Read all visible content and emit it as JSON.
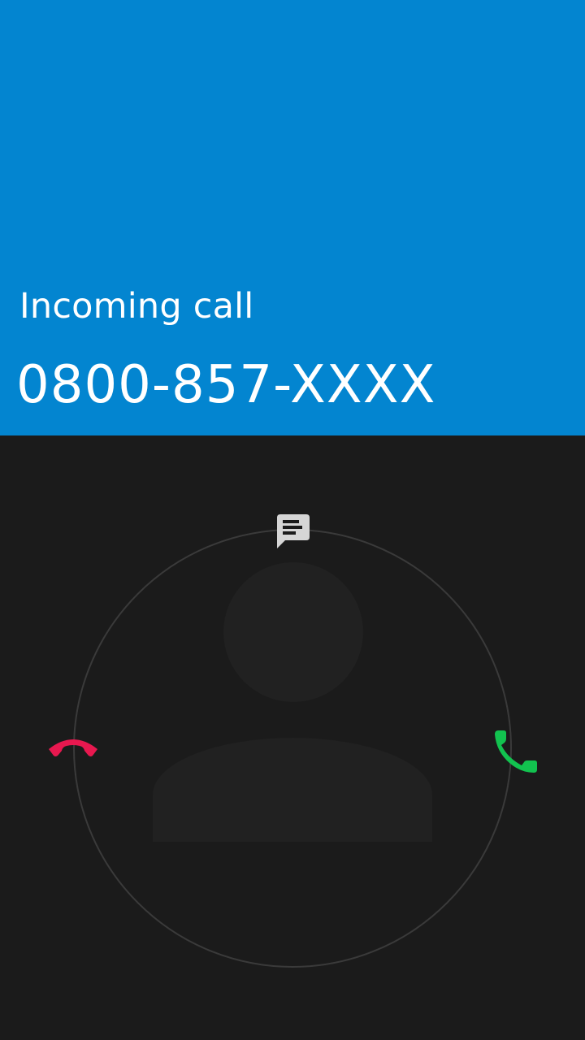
{
  "call": {
    "state_label": "Incoming call",
    "phone_number": "0800-857-XXXX"
  },
  "actions": {
    "decline_icon": "phone-hangup-icon",
    "answer_icon": "phone-answer-icon",
    "message_icon": "message-reply-icon"
  },
  "colors": {
    "header": "#0385d0",
    "background": "#1b1b1b",
    "decline": "#e8184f",
    "answer": "#12c24f",
    "message": "#d6d6d6"
  }
}
